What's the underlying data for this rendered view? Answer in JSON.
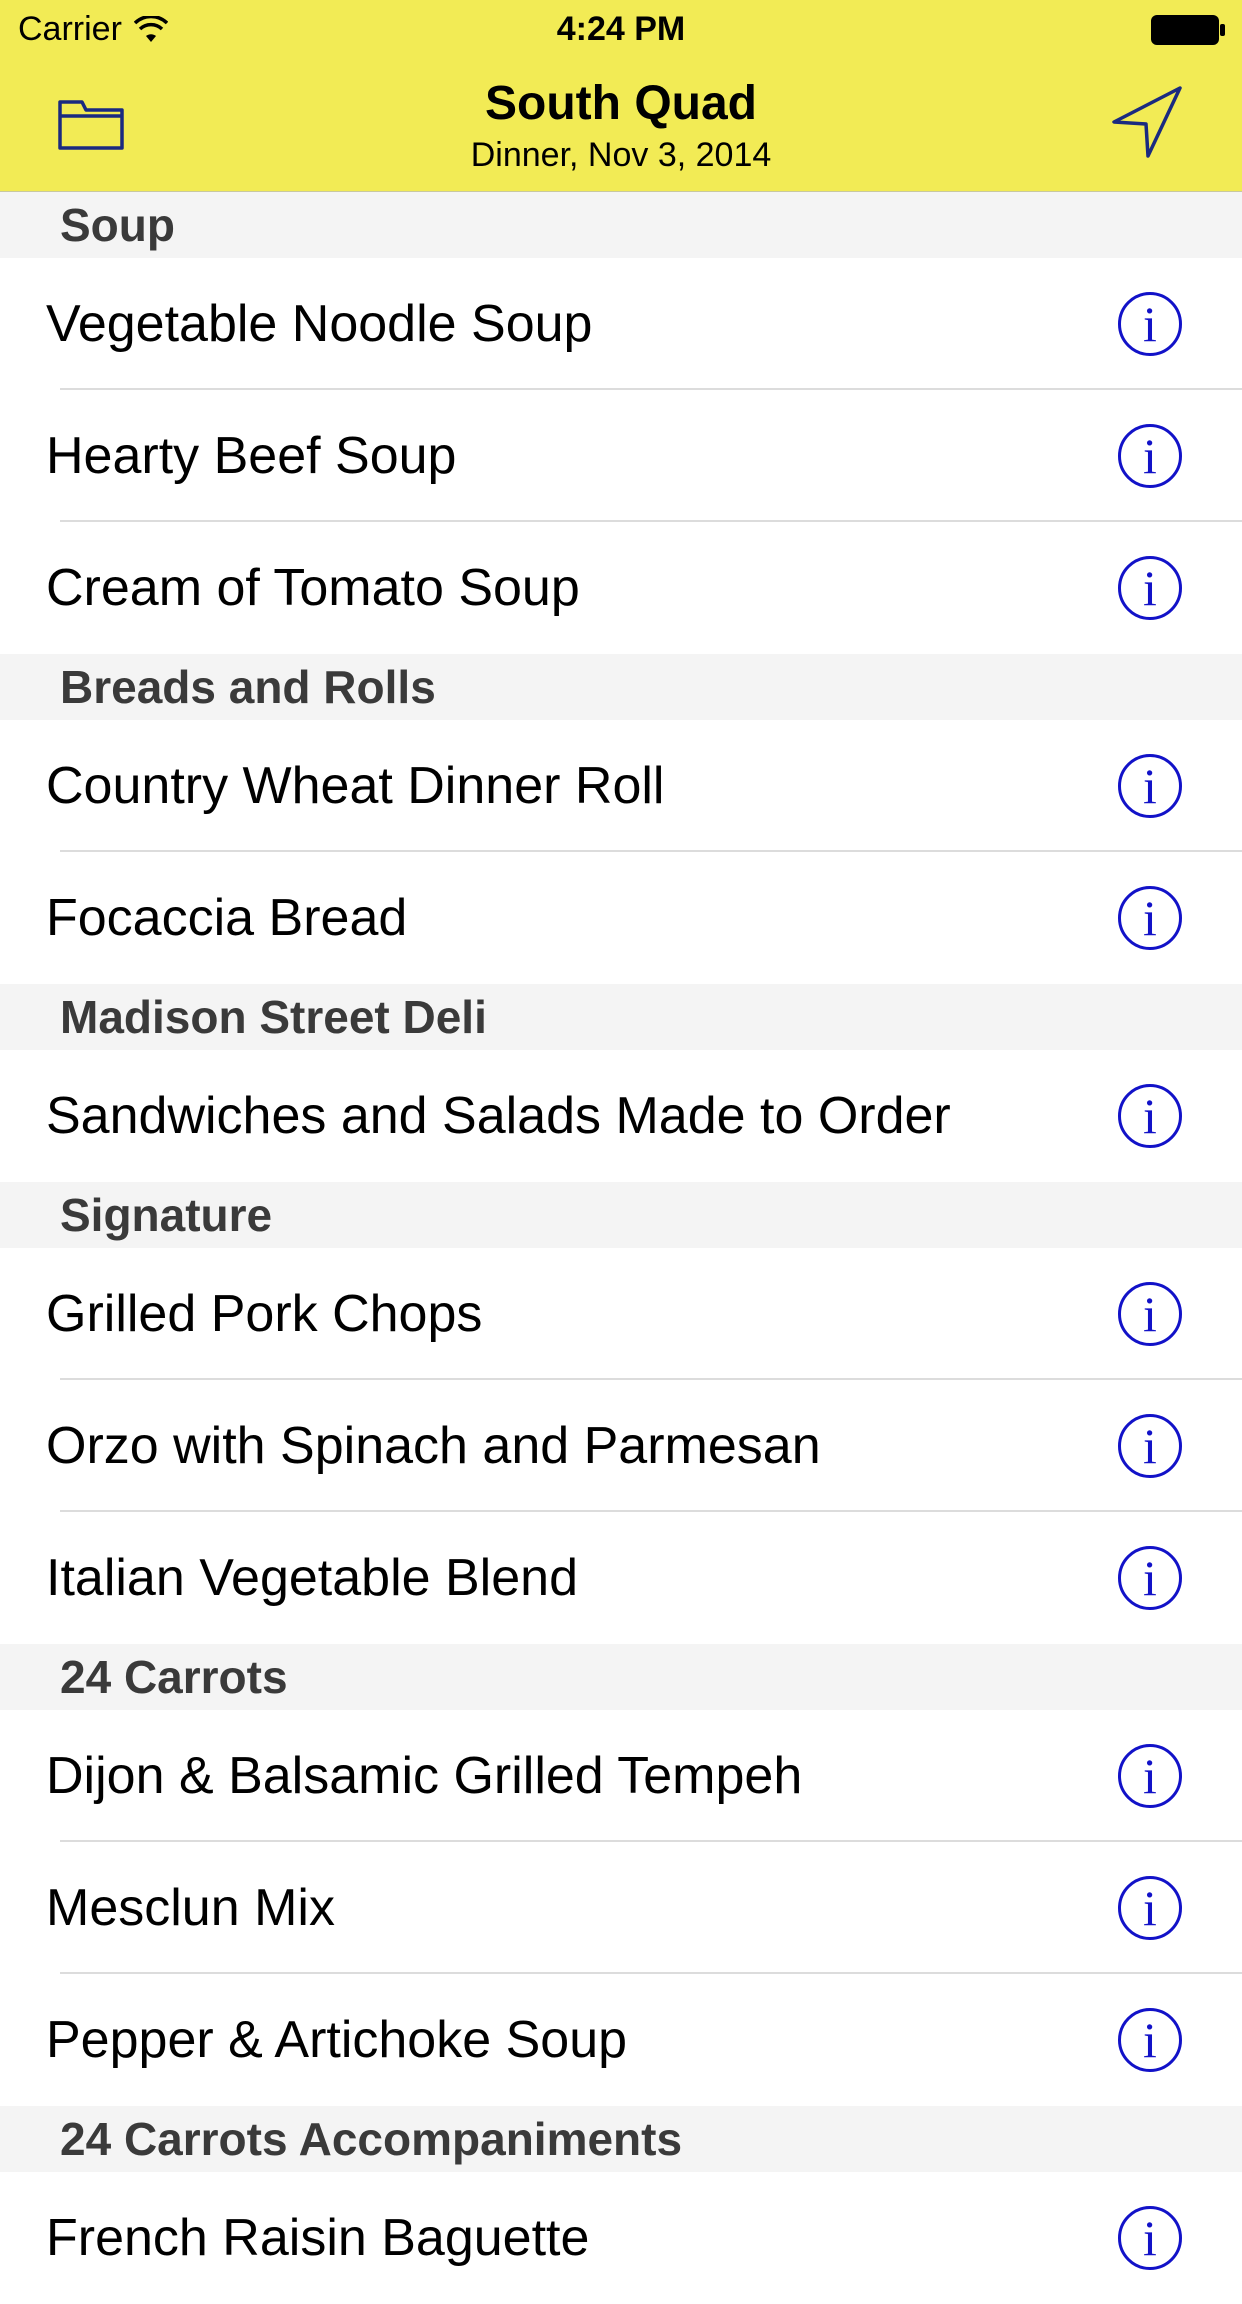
{
  "status_bar": {
    "carrier": "Carrier",
    "time": "4:24 PM"
  },
  "nav": {
    "title": "South Quad",
    "subtitle": "Dinner, Nov 3, 2014",
    "left_icon": "folder-icon",
    "right_icon": "location-arrow-icon"
  },
  "info_glyph": "i",
  "colors": {
    "header_bg": "#f2eb55",
    "info_accent": "#1212c8",
    "section_bg": "#f4f4f4"
  },
  "sections": [
    {
      "title": "Soup",
      "items": [
        "Vegetable Noodle Soup",
        "Hearty Beef Soup",
        "Cream of Tomato Soup"
      ]
    },
    {
      "title": "Breads and Rolls",
      "items": [
        "Country Wheat Dinner Roll",
        "Focaccia Bread"
      ]
    },
    {
      "title": "Madison Street Deli",
      "items": [
        "Sandwiches and Salads Made to Order"
      ]
    },
    {
      "title": "Signature",
      "items": [
        "Grilled Pork Chops",
        "Orzo with Spinach and Parmesan",
        "Italian Vegetable Blend"
      ]
    },
    {
      "title": "24 Carrots",
      "items": [
        "Dijon & Balsamic Grilled Tempeh",
        "Mesclun Mix",
        "Pepper & Artichoke Soup"
      ]
    },
    {
      "title": "24 Carrots Accompaniments",
      "items": [
        "French Raisin Baguette"
      ]
    }
  ]
}
